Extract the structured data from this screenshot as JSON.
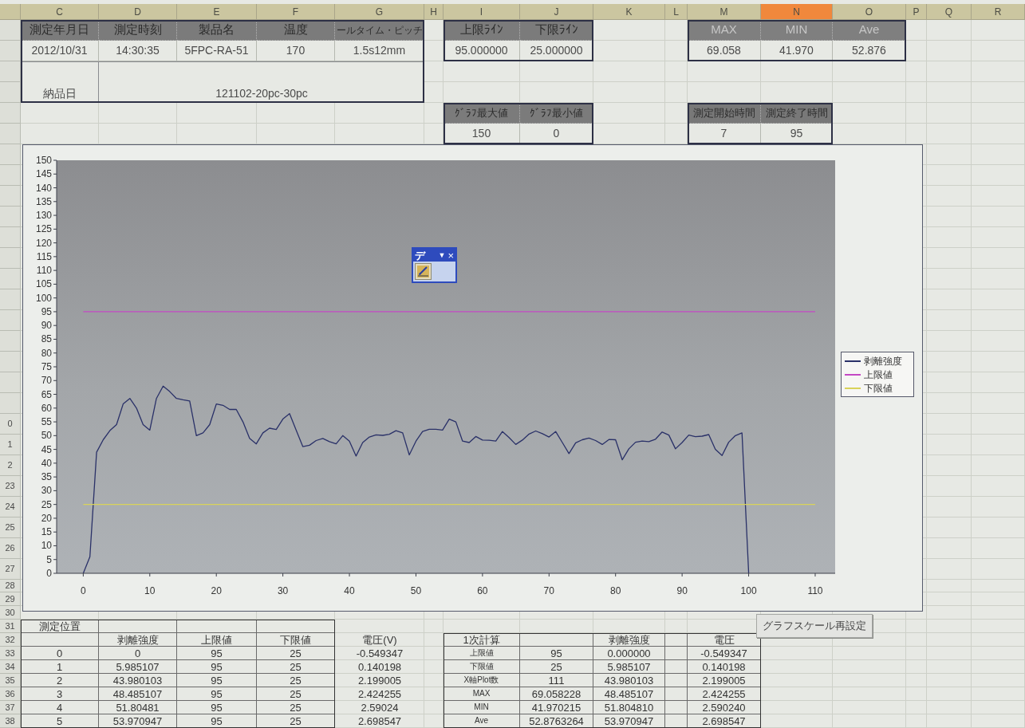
{
  "columns": [
    {
      "label": "C",
      "selected": false
    },
    {
      "label": "D",
      "selected": false
    },
    {
      "label": "E",
      "selected": false
    },
    {
      "label": "F",
      "selected": false
    },
    {
      "label": "G",
      "selected": false
    },
    {
      "label": "H",
      "selected": false
    },
    {
      "label": "I",
      "selected": false
    },
    {
      "label": "J",
      "selected": false
    },
    {
      "label": "K",
      "selected": false
    },
    {
      "label": "L",
      "selected": false
    },
    {
      "label": "M",
      "selected": false
    },
    {
      "label": "N",
      "selected": true
    },
    {
      "label": "O",
      "selected": false
    },
    {
      "label": "P",
      "selected": false
    },
    {
      "label": "Q",
      "selected": false
    },
    {
      "label": "R",
      "selected": false
    }
  ],
  "row_numbers": [
    "0",
    "1",
    "2",
    "23",
    "24",
    "25",
    "26",
    "27",
    "28",
    "29",
    "30",
    "31",
    "32",
    "33",
    "34",
    "35",
    "36",
    "37",
    "38"
  ],
  "product_table": {
    "headers": [
      "測定年月日",
      "測定時刻",
      "製品名",
      "温度",
      "ールタイム・ピッチ"
    ],
    "values": [
      "2012/10/31",
      "14:30:35",
      "5FPC-RA-51",
      "170",
      "1.5s12mm"
    ],
    "delivery": {
      "label": "納品日",
      "value": "121102-20pc-30pc"
    }
  },
  "limit_table": {
    "headers": [
      "上限ﾗｲﾝ",
      "下限ﾗｲﾝ"
    ],
    "values": [
      "95.000000",
      "25.000000"
    ]
  },
  "stats_table": {
    "headers": [
      "MAX",
      "MIN",
      "Ave"
    ],
    "values": [
      "69.058",
      "41.970",
      "52.876"
    ]
  },
  "scale_table": {
    "headers": [
      "ｸﾞﾗﾌ最大値",
      "ｸﾞﾗﾌ最小値"
    ],
    "values": [
      "150",
      "0"
    ]
  },
  "time_table": {
    "headers": [
      "測定開始時間",
      "測定終了時間"
    ],
    "values": [
      "7",
      "95"
    ]
  },
  "chart": {
    "chart_data": {
      "type": "line",
      "legend": "right",
      "x": [
        0,
        1,
        2,
        3,
        4,
        5,
        6,
        7,
        8,
        9,
        10,
        11,
        12,
        13,
        14,
        15,
        16,
        17,
        18,
        19,
        20,
        21,
        22,
        23,
        24,
        25,
        26,
        27,
        28,
        29,
        30,
        31,
        32,
        33,
        34,
        35,
        36,
        37,
        38,
        39,
        40,
        41,
        42,
        43,
        44,
        45,
        46,
        47,
        48,
        49,
        50,
        51,
        52,
        53,
        54,
        55,
        56,
        57,
        58,
        59,
        60,
        61,
        62,
        63,
        64,
        65,
        66,
        67,
        68,
        69,
        70,
        71,
        72,
        73,
        74,
        75,
        76,
        77,
        78,
        79,
        80,
        81,
        82,
        83,
        84,
        85,
        86,
        87,
        88,
        89,
        90,
        91,
        92,
        93,
        94,
        95,
        96,
        97,
        98,
        99,
        100,
        101,
        102,
        103,
        104,
        105,
        106,
        107,
        108,
        109,
        110
      ],
      "series": [
        {
          "name": "剥離強度",
          "color": "#2a3168",
          "values": [
            0,
            6,
            44,
            48.5,
            51.8,
            54,
            61.5,
            63.5,
            60,
            54,
            52,
            63.5,
            68,
            66,
            63.5,
            63,
            62.6,
            50,
            51,
            54,
            61.5,
            61,
            59.5,
            59.5,
            55,
            49,
            47,
            51,
            52.7,
            52.2,
            56,
            58,
            52,
            46,
            46.5,
            48.2,
            49,
            47.8,
            47,
            50,
            48,
            42.6,
            47.5,
            49.5,
            50.3,
            50.1,
            50.5,
            51.8,
            51,
            43,
            48,
            51.5,
            52.3,
            52.3,
            52,
            56,
            55,
            48,
            47.5,
            49.7,
            48.4,
            48.3,
            48,
            51.5,
            49.3,
            46.8,
            48.4,
            50.6,
            51.7,
            50.7,
            49.5,
            51.5,
            47.5,
            43.5,
            47.4,
            48.5,
            49.1,
            48.2,
            46.8,
            48.6,
            48.5,
            41.2,
            45.2,
            47.6,
            48,
            47.8,
            48.7,
            51.3,
            50.2,
            45.2,
            47.5,
            50.2,
            49.6,
            49.8,
            50.4,
            45,
            42.8,
            47.6,
            50,
            51,
            0,
            null,
            null,
            null,
            null,
            null,
            null,
            null,
            null,
            null,
            null
          ]
        },
        {
          "name": "上限値",
          "color": "#c448c4",
          "values": [
            95,
            95,
            95,
            95,
            95,
            95,
            95,
            95,
            95,
            95,
            95,
            95,
            95,
            95,
            95,
            95,
            95,
            95,
            95,
            95,
            95,
            95,
            95,
            95,
            95,
            95,
            95,
            95,
            95,
            95,
            95,
            95,
            95,
            95,
            95,
            95,
            95,
            95,
            95,
            95,
            95,
            95,
            95,
            95,
            95,
            95,
            95,
            95,
            95,
            95,
            95,
            95,
            95,
            95,
            95,
            95,
            95,
            95,
            95,
            95,
            95,
            95,
            95,
            95,
            95,
            95,
            95,
            95,
            95,
            95,
            95,
            95,
            95,
            95,
            95,
            95,
            95,
            95,
            95,
            95,
            95,
            95,
            95,
            95,
            95,
            95,
            95,
            95,
            95,
            95,
            95,
            95,
            95,
            95,
            95,
            95,
            95,
            95,
            95,
            95,
            95,
            95,
            95,
            95,
            95,
            95,
            95,
            95,
            95,
            95,
            95
          ]
        },
        {
          "name": "下限値",
          "color": "#d9d35a",
          "values": [
            25,
            25,
            25,
            25,
            25,
            25,
            25,
            25,
            25,
            25,
            25,
            25,
            25,
            25,
            25,
            25,
            25,
            25,
            25,
            25,
            25,
            25,
            25,
            25,
            25,
            25,
            25,
            25,
            25,
            25,
            25,
            25,
            25,
            25,
            25,
            25,
            25,
            25,
            25,
            25,
            25,
            25,
            25,
            25,
            25,
            25,
            25,
            25,
            25,
            25,
            25,
            25,
            25,
            25,
            25,
            25,
            25,
            25,
            25,
            25,
            25,
            25,
            25,
            25,
            25,
            25,
            25,
            25,
            25,
            25,
            25,
            25,
            25,
            25,
            25,
            25,
            25,
            25,
            25,
            25,
            25,
            25,
            25,
            25,
            25,
            25,
            25,
            25,
            25,
            25,
            25,
            25,
            25,
            25,
            25,
            25,
            25,
            25,
            25,
            25,
            25,
            25,
            25,
            25,
            25,
            25,
            25,
            25,
            25,
            25,
            25
          ]
        }
      ],
      "xlim": [
        -4,
        113
      ],
      "ylim": [
        0,
        150
      ],
      "xticks": [
        0,
        10,
        20,
        30,
        40,
        50,
        60,
        70,
        80,
        90,
        100,
        110
      ],
      "yticks": [
        0,
        5,
        10,
        15,
        20,
        25,
        30,
        35,
        40,
        45,
        50,
        55,
        60,
        65,
        70,
        75,
        80,
        85,
        90,
        95,
        100,
        105,
        110,
        115,
        120,
        125,
        130,
        135,
        140,
        145,
        150
      ]
    }
  },
  "floating_toolbar": {
    "title": "デ",
    "dropdown": "▼",
    "close": "×"
  },
  "measurement_table": {
    "header_rows": [
      [
        "測定位置",
        "",
        "",
        ""
      ],
      [
        "",
        "剥離強度",
        "上限値",
        "下限値"
      ]
    ],
    "rows": [
      [
        "0",
        "0",
        "95",
        "25"
      ],
      [
        "1",
        "5.985107",
        "95",
        "25"
      ],
      [
        "2",
        "43.980103",
        "95",
        "25"
      ],
      [
        "3",
        "48.485107",
        "95",
        "25"
      ],
      [
        "4",
        "51.80481",
        "95",
        "25"
      ],
      [
        "5",
        "53.970947",
        "95",
        "25"
      ]
    ]
  },
  "voltage_column": {
    "header": "電圧(V)",
    "values": [
      "-0.549347",
      "0.140198",
      "2.199005",
      "2.424255",
      "2.59024",
      "2.698547"
    ]
  },
  "calc_table": {
    "columns": [
      "1次計算",
      "",
      "剥離強度",
      "",
      "電圧"
    ],
    "rows": [
      [
        "上限値",
        "95",
        "0.000000",
        "",
        "-0.549347"
      ],
      [
        "下限値",
        "25",
        "5.985107",
        "",
        "0.140198"
      ],
      [
        "X軸Plot数",
        "111",
        "43.980103",
        "",
        "2.199005"
      ],
      [
        "MAX",
        "69.058228",
        "48.485107",
        "",
        "2.424255"
      ],
      [
        "MIN",
        "41.970215",
        "51.804810",
        "",
        "2.590240"
      ],
      [
        "Ave",
        "52.8763264",
        "53.970947",
        "",
        "2.698547"
      ]
    ]
  },
  "rescale_button": {
    "label": "グラフスケール再設定"
  }
}
